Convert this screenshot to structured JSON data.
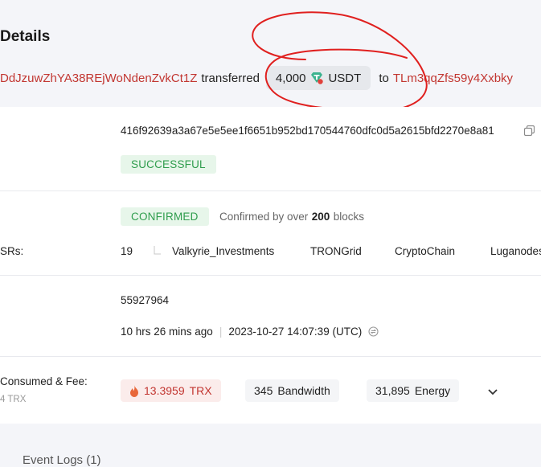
{
  "page": {
    "title": "Details"
  },
  "transfer": {
    "from": "DdJzuwZhYA38REjWoNdenZvkCt1Z",
    "verb": "transferred",
    "amount": "4,000",
    "token": "USDT",
    "to_word": "to",
    "to": "TLm3qqZfs59y4Xxbky"
  },
  "hash": {
    "value": "416f92639a3a67e5e5ee1f6651b952bd170544760dfc0d5a2615bfd2270e8a81"
  },
  "result": {
    "status": "SUCCESSFUL"
  },
  "confirmation": {
    "status": "CONFIRMED",
    "text_prefix": "Confirmed by over",
    "count": "200",
    "text_suffix": "blocks"
  },
  "srs": {
    "label": "SRs:",
    "count": "19",
    "items": [
      "Valkyrie_Investments",
      "TRONGrid",
      "CryptoChain",
      "Luganodes"
    ]
  },
  "block": {
    "number": "55927964"
  },
  "time": {
    "relative": "10 hrs 26 mins ago",
    "separator": "|",
    "absolute": "2023-10-27 14:07:39 (UTC)"
  },
  "resources": {
    "label": "Consumed & Fee:",
    "sub": "4 TRX",
    "trx_value": "13.3959",
    "trx_unit": "TRX",
    "bandwidth_value": "345",
    "bandwidth_unit": "Bandwidth",
    "energy_value": "31,895",
    "energy_unit": "Energy"
  },
  "event_logs": {
    "label": "Event Logs (1)"
  },
  "colors": {
    "address": "#c23631",
    "success": "#2f9d4d",
    "annotation": "#e0201f"
  },
  "icons": [
    "tether-icon",
    "copy-icon",
    "corner-icon",
    "flame-icon",
    "clock-convert-icon",
    "chevron-down-icon"
  ]
}
